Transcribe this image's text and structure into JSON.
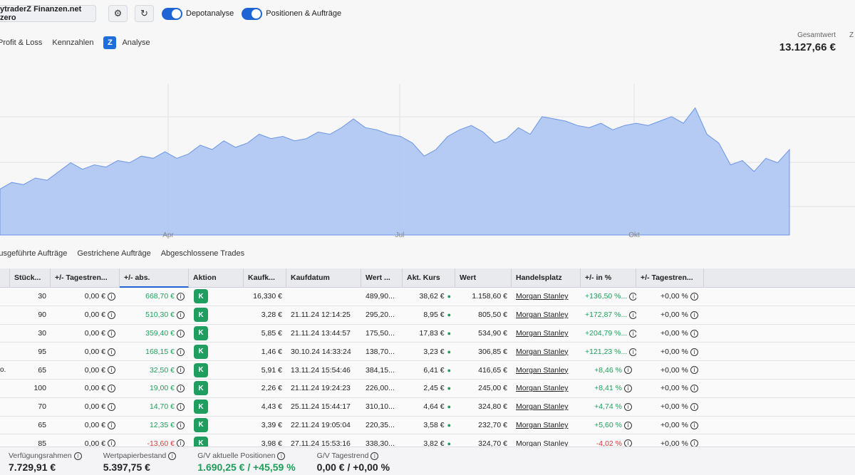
{
  "toolbar": {
    "account": "ytraderZ Finanzen.net zero",
    "settings_icon": "gear-icon",
    "refresh_icon": "refresh-icon",
    "toggle_depot": "Depotanalyse",
    "toggle_positions": "Positionen & Aufträge"
  },
  "subnav": {
    "pnl": "Profit & Loss",
    "kennzahlen": "Kennzahlen",
    "analyse": "Analyse",
    "analyse_logo": "Z"
  },
  "summary": {
    "gesamt_label": "Gesamtwert",
    "gesamt_value": "13.127,66 €",
    "z_label": "Z"
  },
  "chart_data": {
    "type": "area",
    "x_ticks": [
      "Apr",
      "Jul",
      "Okt"
    ],
    "color": "#7ea6ec",
    "values": [
      10.1,
      10.4,
      10.3,
      10.6,
      10.5,
      10.9,
      11.3,
      11.0,
      11.2,
      11.1,
      11.4,
      11.3,
      11.6,
      11.5,
      11.8,
      11.5,
      11.7,
      12.1,
      11.9,
      12.3,
      12.0,
      12.2,
      12.6,
      12.4,
      12.5,
      12.3,
      12.4,
      12.7,
      12.6,
      12.9,
      13.3,
      12.9,
      12.8,
      12.6,
      12.5,
      12.2,
      11.6,
      11.9,
      12.5,
      12.8,
      13.0,
      12.7,
      12.2,
      12.4,
      12.9,
      12.6,
      13.4,
      13.3,
      13.2,
      13.0,
      12.9,
      13.1,
      12.8,
      13.0,
      13.1,
      13.0,
      13.2,
      13.4,
      13.1,
      13.8,
      12.6,
      12.2,
      11.2,
      11.4,
      10.9,
      11.5,
      11.3,
      11.9
    ]
  },
  "tabs": [
    "Ausgeführte Aufträge",
    "Gestrichene Aufträge",
    "Abgeschlossene Trades"
  ],
  "table": {
    "headers": [
      "Stück...",
      "+/- Tagestren...",
      "+/- abs.",
      "Aktion",
      "Kaufk...",
      "Kaufdatum",
      "Wert ...",
      "Akt. Kurs",
      "Wert",
      "Handelsplatz",
      "+/- in %",
      "+/- Tagestren..."
    ],
    "rows": [
      {
        "pre": "",
        "qty": "30",
        "day": "0,00 €",
        "abs": "668,70 €",
        "absc": "green",
        "k": "K",
        "kaufk": "16,330 €",
        "date": "",
        "wert1": "489,90...",
        "kurs": "38,62 €",
        "wert": "1.158,60 €",
        "place": "Morgan Stanley",
        "pct": "+136,50 %...",
        "pctc": "green",
        "day2": "+0,00 %"
      },
      {
        "pre": "",
        "qty": "90",
        "day": "0,00 €",
        "abs": "510,30 €",
        "absc": "green",
        "k": "K",
        "kaufk": "3,28 €",
        "date": "21.11.24 12:14:25",
        "wert1": "295,20...",
        "kurs": "8,95 €",
        "wert": "805,50 €",
        "place": "Morgan Stanley",
        "pct": "+172,87 %...",
        "pctc": "green",
        "day2": "+0,00 %"
      },
      {
        "pre": "",
        "qty": "30",
        "day": "0,00 €",
        "abs": "359,40 €",
        "absc": "green",
        "k": "K",
        "kaufk": "5,85 €",
        "date": "21.11.24 13:44:57",
        "wert1": "175,50...",
        "kurs": "17,83 €",
        "wert": "534,90 €",
        "place": "Morgan Stanley",
        "pct": "+204,79 %...",
        "pctc": "green",
        "day2": "+0,00 %"
      },
      {
        "pre": "",
        "qty": "95",
        "day": "0,00 €",
        "abs": "168,15 €",
        "absc": "green",
        "k": "K",
        "kaufk": "1,46 €",
        "date": "30.10.24 14:33:24",
        "wert1": "138,70...",
        "kurs": "3,23 €",
        "wert": "306,85 €",
        "place": "Morgan Stanley",
        "pct": "+121,23 %...",
        "pctc": "green",
        "day2": "+0,00 %"
      },
      {
        "pre": "o.",
        "qty": "65",
        "day": "0,00 €",
        "abs": "32,50 €",
        "absc": "green",
        "k": "K",
        "kaufk": "5,91 €",
        "date": "13.11.24 15:54:46",
        "wert1": "384,15...",
        "kurs": "6,41 €",
        "wert": "416,65 €",
        "place": "Morgan Stanley",
        "pct": "+8,46 %",
        "pctc": "green",
        "day2": "+0,00 %"
      },
      {
        "pre": "",
        "qty": "100",
        "day": "0,00 €",
        "abs": "19,00 €",
        "absc": "green",
        "k": "K",
        "kaufk": "2,26 €",
        "date": "21.11.24 19:24:23",
        "wert1": "226,00...",
        "kurs": "2,45 €",
        "wert": "245,00 €",
        "place": "Morgan Stanley",
        "pct": "+8,41 %",
        "pctc": "green",
        "day2": "+0,00 %"
      },
      {
        "pre": "",
        "qty": "70",
        "day": "0,00 €",
        "abs": "14,70 €",
        "absc": "green",
        "k": "K",
        "kaufk": "4,43 €",
        "date": "25.11.24 15:44:17",
        "wert1": "310,10...",
        "kurs": "4,64 €",
        "wert": "324,80 €",
        "place": "Morgan Stanley",
        "pct": "+4,74 %",
        "pctc": "green",
        "day2": "+0,00 %"
      },
      {
        "pre": "",
        "qty": "65",
        "day": "0,00 €",
        "abs": "12,35 €",
        "absc": "green",
        "k": "K",
        "kaufk": "3,39 €",
        "date": "22.11.24 19:05:04",
        "wert1": "220,35...",
        "kurs": "3,58 €",
        "wert": "232,70 €",
        "place": "Morgan Stanley",
        "pct": "+5,60 %",
        "pctc": "green",
        "day2": "+0,00 %"
      },
      {
        "pre": "",
        "qty": "85",
        "day": "0,00 €",
        "abs": "-13,60 €",
        "absc": "red",
        "k": "K",
        "kaufk": "3,98 €",
        "date": "27.11.24 15:53:16",
        "wert1": "338,30...",
        "kurs": "3,82 €",
        "wert": "324,70 €",
        "place": "Morgan Stanley",
        "pct": "-4,02 %",
        "pctc": "red",
        "day2": "+0,00 %"
      }
    ]
  },
  "footer": {
    "verf_label": "Verfügungsrahmen",
    "verf_value": "7.729,91 €",
    "wp_label": "Wertpapierbestand",
    "wp_value": "5.397,75 €",
    "gv_label": "G/V aktuelle Positionen",
    "gv_value_green": "1.690,25 € / +45,59 %",
    "gvt_label": "G/V Tagestrend",
    "gvt_value": "0,00 € / +0,00 %"
  }
}
